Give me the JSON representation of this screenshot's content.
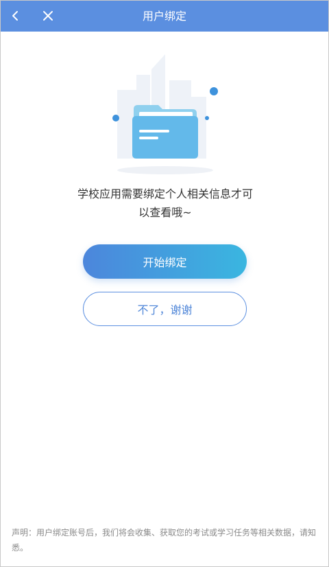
{
  "navbar": {
    "title": "用户绑定",
    "background": "#5b8fe0",
    "back_icon": "chevron-left-icon",
    "close_icon": "close-icon"
  },
  "main": {
    "illustration_icon": "folder-icon",
    "message_line1": "学校应用需要绑定个人相关信息才可",
    "message_line2": "以查看哦~",
    "start_bind_label": "开始绑定",
    "decline_label": "不了，谢谢"
  },
  "footer": {
    "disclaimer": "声明：用户绑定账号后，我们将会收集、获取您的考试或学习任务等相关数据，请知悉。"
  },
  "colors": {
    "accent": "#5b8fe0",
    "button_gradient_start": "#4c86dc",
    "button_gradient_end": "#3ab6e0"
  }
}
